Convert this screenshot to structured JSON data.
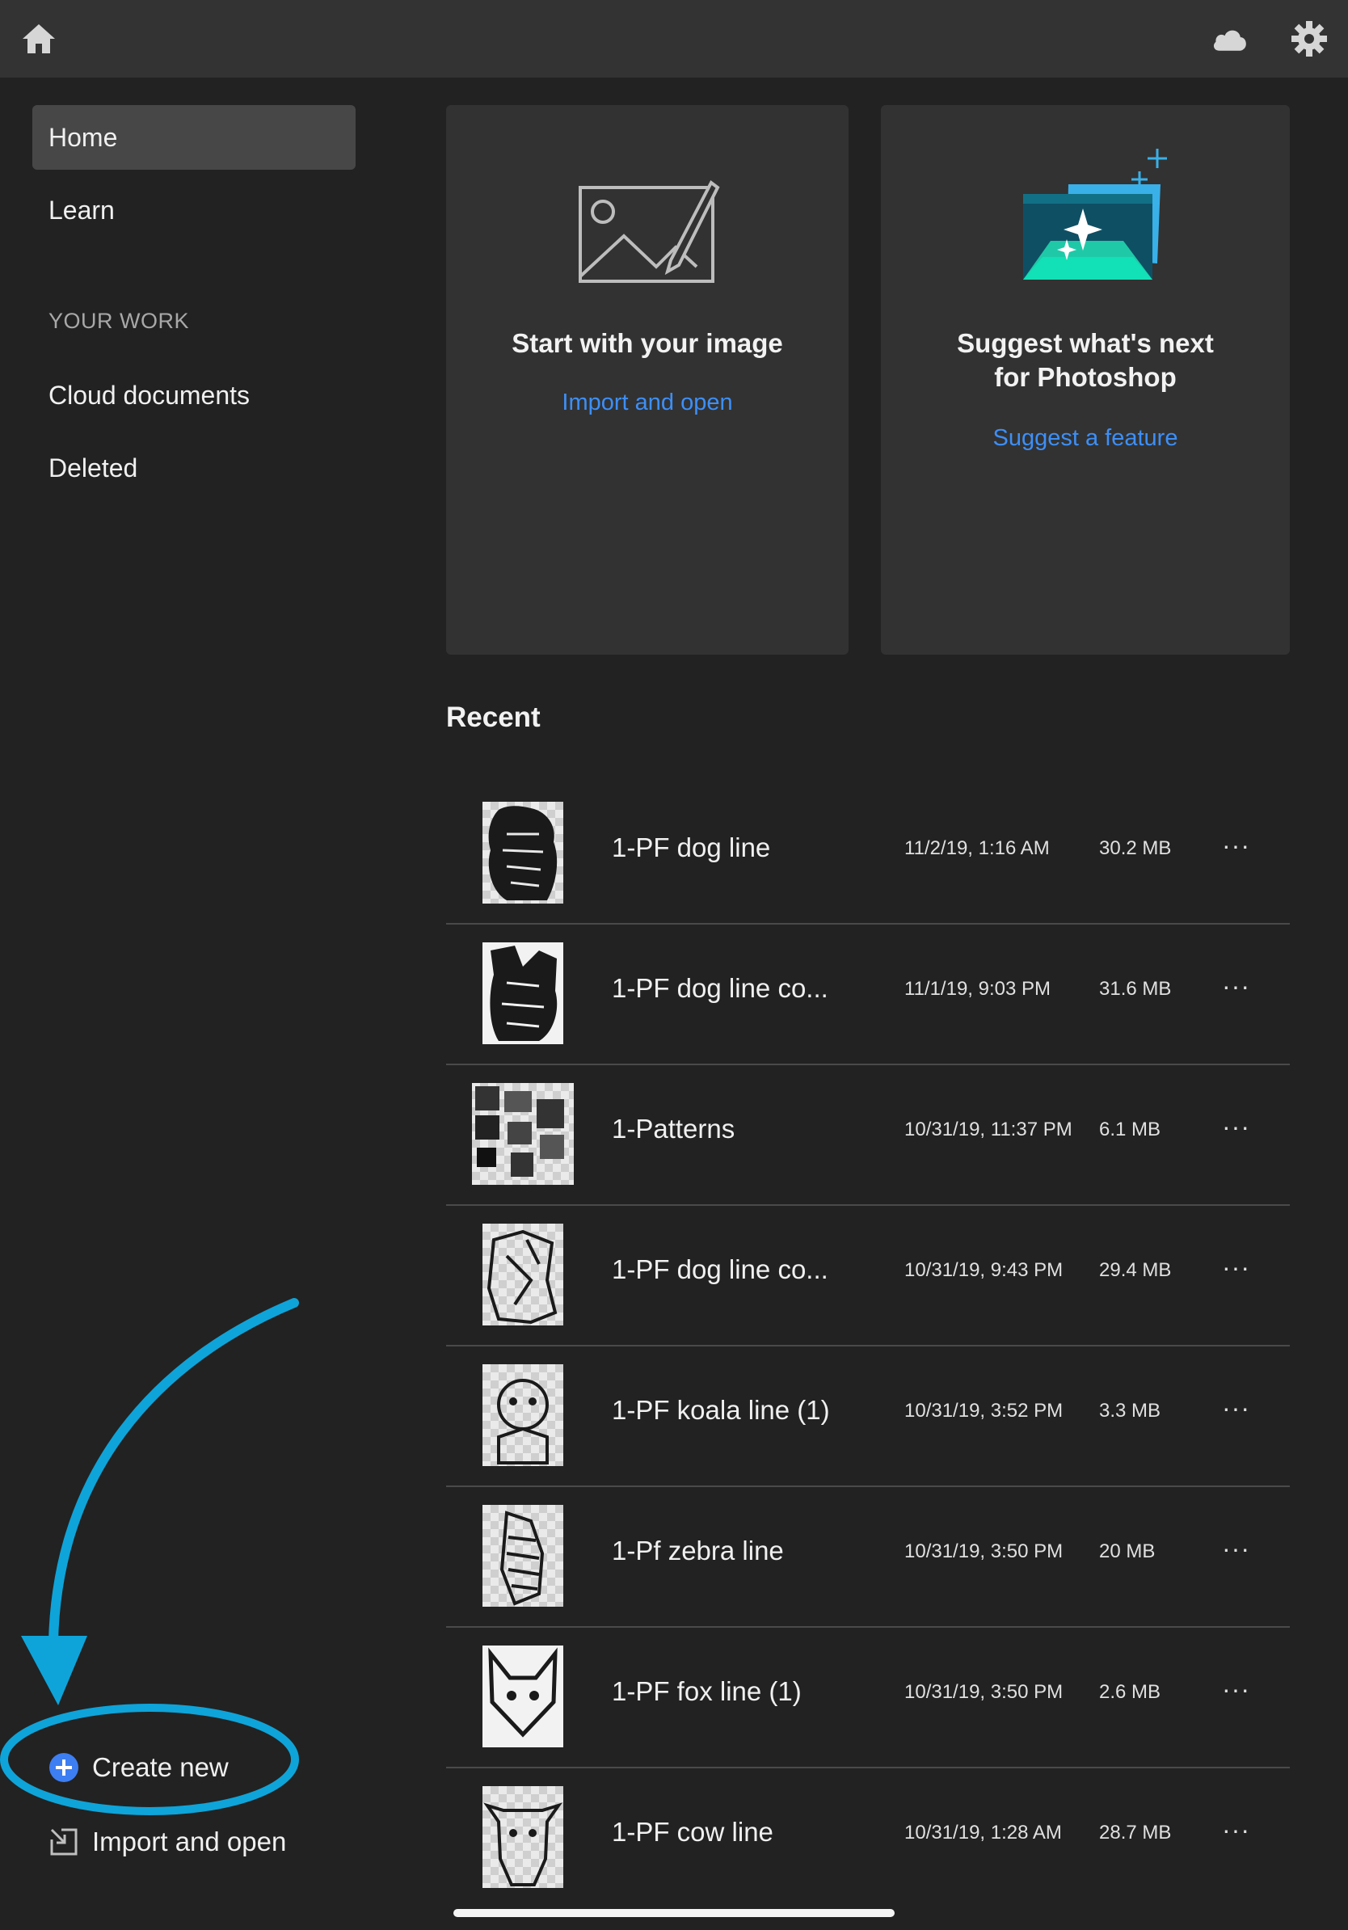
{
  "sidebar": {
    "items": [
      {
        "label": "Home"
      },
      {
        "label": "Learn"
      }
    ],
    "section_label": "YOUR WORK",
    "work_items": [
      {
        "label": "Cloud documents"
      },
      {
        "label": "Deleted"
      }
    ],
    "create_new_label": "Create new",
    "import_label": "Import and open"
  },
  "cards": {
    "start": {
      "title": "Start with your image",
      "link": "Import and open"
    },
    "suggest": {
      "title_line1": "Suggest what's next",
      "title_line2": "for Photoshop",
      "link": "Suggest a feature"
    }
  },
  "recent": {
    "title": "Recent",
    "rows": [
      {
        "name": "1-PF dog line",
        "date": "11/2/19, 1:16 AM",
        "size": "30.2 MB",
        "more": "···"
      },
      {
        "name": "1-PF dog line co...",
        "date": "11/1/19, 9:03 PM",
        "size": "31.6 MB",
        "more": "···"
      },
      {
        "name": "1-Patterns",
        "date": "10/31/19, 11:37 PM",
        "size": "6.1 MB",
        "more": "···"
      },
      {
        "name": "1-PF dog line co...",
        "date": "10/31/19, 9:43 PM",
        "size": "29.4 MB",
        "more": "···"
      },
      {
        "name": "1-PF koala line (1)",
        "date": "10/31/19, 3:52 PM",
        "size": "3.3 MB",
        "more": "···"
      },
      {
        "name": "1-Pf zebra line",
        "date": "10/31/19, 3:50 PM",
        "size": "20 MB",
        "more": "···"
      },
      {
        "name": "1-PF fox line (1)",
        "date": "10/31/19, 3:50 PM",
        "size": "2.6 MB",
        "more": "···"
      },
      {
        "name": "1-PF cow line",
        "date": "10/31/19, 1:28 AM",
        "size": "28.7 MB",
        "more": "···"
      }
    ]
  },
  "icons": {
    "home": "home-icon",
    "cloud": "cloud-icon",
    "settings": "gear-icon",
    "create": "plus-circle-icon",
    "import": "import-icon"
  },
  "colors": {
    "background": "#222222",
    "topbar": "#333333",
    "card": "#323232",
    "link": "#3d8ff7",
    "annotation": "#0ea4d9"
  }
}
